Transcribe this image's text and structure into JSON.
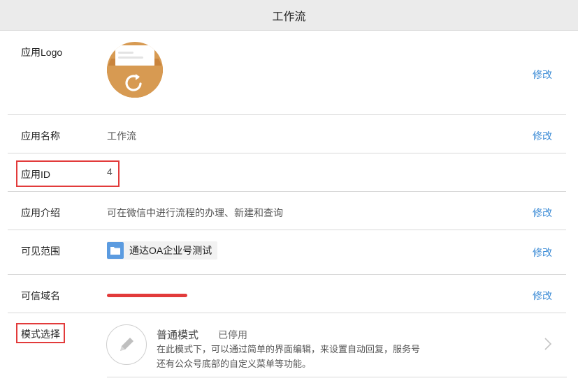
{
  "header": {
    "title": "工作流"
  },
  "rows": {
    "logo": {
      "label": "应用Logo",
      "action": "修改"
    },
    "name": {
      "label": "应用名称",
      "value": "工作流",
      "action": "修改"
    },
    "id": {
      "label": "应用ID",
      "value": "4"
    },
    "intro": {
      "label": "应用介绍",
      "value": "可在微信中进行流程的办理、新建和查询",
      "action": "修改"
    },
    "scope": {
      "label": "可见范围",
      "chip": "通达OA企业号测试",
      "action": "修改"
    },
    "domain": {
      "label": "可信域名",
      "action": "修改"
    },
    "mode": {
      "label": "模式选择",
      "title": "普通模式",
      "status": "已停用",
      "desc_line1": "在此模式下，可以通过简单的界面编辑，来设置自动回复，服务号",
      "desc_line2": "还有公众号底部的自定义菜单等功能。"
    }
  },
  "colors": {
    "accent": "#3d8cd6",
    "highlight": "#e23b3b",
    "logo": "#d79a52",
    "folder": "#5b9be0"
  },
  "icons": [
    "app-logo-refresh-icon",
    "folder-icon",
    "pencil-icon",
    "chevron-right-icon"
  ]
}
